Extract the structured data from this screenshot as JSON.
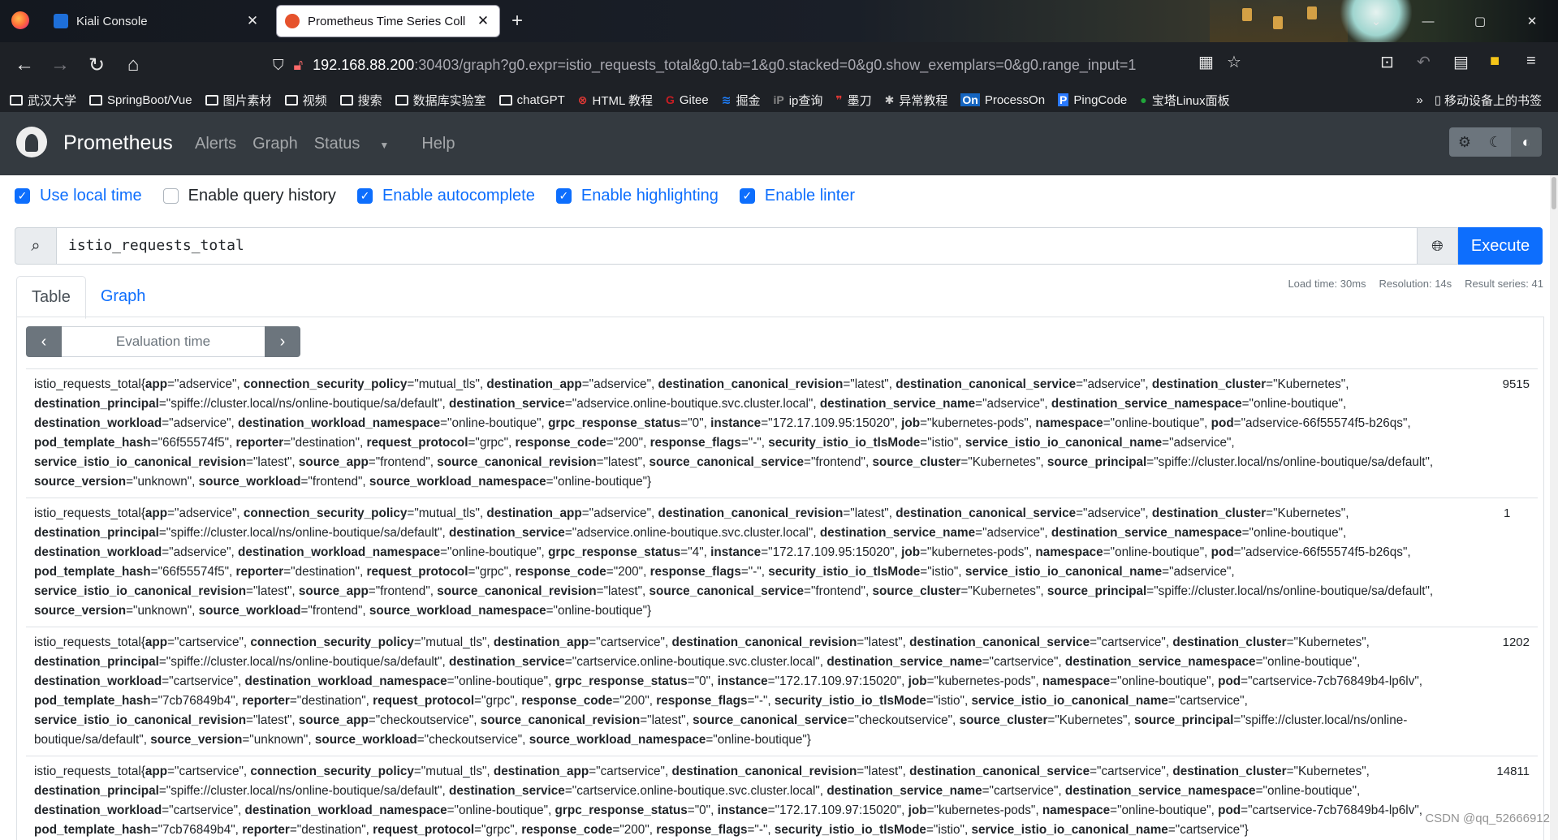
{
  "browser": {
    "tabs": [
      {
        "title": "Kiali Console",
        "active": false
      },
      {
        "title": "Prometheus Time Series Coll",
        "active": true
      }
    ],
    "url_host": "192.168.88.200",
    "url_rest": ":30403/graph?g0.expr=istio_requests_total&g0.tab=1&g0.stacked=0&g0.show_exemplars=0&g0.range_input=1",
    "bookmarks": [
      "武汉大学",
      "SpringBoot/Vue",
      "图片素材",
      "视频",
      "搜索",
      "数据库实验室",
      "chatGPT",
      "HTML 教程",
      "Gitee",
      "掘金",
      "ip查询",
      "墨刀",
      "异常教程",
      "ProcessOn",
      "PingCode",
      "宝塔Linux面板"
    ],
    "mobile_bookmarks": "移动设备上的书签"
  },
  "prometheus": {
    "brand": "Prometheus",
    "nav": [
      "Alerts",
      "Graph",
      "Status",
      "Help"
    ]
  },
  "options": [
    {
      "label": "Use local time",
      "checked": true
    },
    {
      "label": "Enable query history",
      "checked": false
    },
    {
      "label": "Enable autocomplete",
      "checked": true
    },
    {
      "label": "Enable highlighting",
      "checked": true
    },
    {
      "label": "Enable linter",
      "checked": true
    }
  ],
  "query": {
    "expression": "istio_requests_total",
    "execute_label": "Execute"
  },
  "tabs": {
    "table": "Table",
    "graph": "Graph"
  },
  "stats": {
    "load_time": "Load time: 30ms",
    "resolution": "Resolution: 14s",
    "result_series": "Result series: 41"
  },
  "eval_time_placeholder": "Evaluation time",
  "results": [
    {
      "metric": "istio_requests_total",
      "value": "9515",
      "labels": [
        [
          "app",
          "adservice"
        ],
        [
          "connection_security_policy",
          "mutual_tls"
        ],
        [
          "destination_app",
          "adservice"
        ],
        [
          "destination_canonical_revision",
          "latest"
        ],
        [
          "destination_canonical_service",
          "adservice"
        ],
        [
          "destination_cluster",
          "Kubernetes"
        ],
        [
          "destination_principal",
          "spiffe://cluster.local/ns/online-boutique/sa/default"
        ],
        [
          "destination_service",
          "adservice.online-boutique.svc.cluster.local"
        ],
        [
          "destination_service_name",
          "adservice"
        ],
        [
          "destination_service_namespace",
          "online-boutique"
        ],
        [
          "destination_workload",
          "adservice"
        ],
        [
          "destination_workload_namespace",
          "online-boutique"
        ],
        [
          "grpc_response_status",
          "0"
        ],
        [
          "instance",
          "172.17.109.95:15020"
        ],
        [
          "job",
          "kubernetes-pods"
        ],
        [
          "namespace",
          "online-boutique"
        ],
        [
          "pod",
          "adservice-66f55574f5-b26qs"
        ],
        [
          "pod_template_hash",
          "66f55574f5"
        ],
        [
          "reporter",
          "destination"
        ],
        [
          "request_protocol",
          "grpc"
        ],
        [
          "response_code",
          "200"
        ],
        [
          "response_flags",
          "-"
        ],
        [
          "security_istio_io_tlsMode",
          "istio"
        ],
        [
          "service_istio_io_canonical_name",
          "adservice"
        ],
        [
          "service_istio_io_canonical_revision",
          "latest"
        ],
        [
          "source_app",
          "frontend"
        ],
        [
          "source_canonical_revision",
          "latest"
        ],
        [
          "source_canonical_service",
          "frontend"
        ],
        [
          "source_cluster",
          "Kubernetes"
        ],
        [
          "source_principal",
          "spiffe://cluster.local/ns/online-boutique/sa/default"
        ],
        [
          "source_version",
          "unknown"
        ],
        [
          "source_workload",
          "frontend"
        ],
        [
          "source_workload_namespace",
          "online-boutique"
        ]
      ]
    },
    {
      "metric": "istio_requests_total",
      "value": "1",
      "labels": [
        [
          "app",
          "adservice"
        ],
        [
          "connection_security_policy",
          "mutual_tls"
        ],
        [
          "destination_app",
          "adservice"
        ],
        [
          "destination_canonical_revision",
          "latest"
        ],
        [
          "destination_canonical_service",
          "adservice"
        ],
        [
          "destination_cluster",
          "Kubernetes"
        ],
        [
          "destination_principal",
          "spiffe://cluster.local/ns/online-boutique/sa/default"
        ],
        [
          "destination_service",
          "adservice.online-boutique.svc.cluster.local"
        ],
        [
          "destination_service_name",
          "adservice"
        ],
        [
          "destination_service_namespace",
          "online-boutique"
        ],
        [
          "destination_workload",
          "adservice"
        ],
        [
          "destination_workload_namespace",
          "online-boutique"
        ],
        [
          "grpc_response_status",
          "4"
        ],
        [
          "instance",
          "172.17.109.95:15020"
        ],
        [
          "job",
          "kubernetes-pods"
        ],
        [
          "namespace",
          "online-boutique"
        ],
        [
          "pod",
          "adservice-66f55574f5-b26qs"
        ],
        [
          "pod_template_hash",
          "66f55574f5"
        ],
        [
          "reporter",
          "destination"
        ],
        [
          "request_protocol",
          "grpc"
        ],
        [
          "response_code",
          "200"
        ],
        [
          "response_flags",
          "-"
        ],
        [
          "security_istio_io_tlsMode",
          "istio"
        ],
        [
          "service_istio_io_canonical_name",
          "adservice"
        ],
        [
          "service_istio_io_canonical_revision",
          "latest"
        ],
        [
          "source_app",
          "frontend"
        ],
        [
          "source_canonical_revision",
          "latest"
        ],
        [
          "source_canonical_service",
          "frontend"
        ],
        [
          "source_cluster",
          "Kubernetes"
        ],
        [
          "source_principal",
          "spiffe://cluster.local/ns/online-boutique/sa/default"
        ],
        [
          "source_version",
          "unknown"
        ],
        [
          "source_workload",
          "frontend"
        ],
        [
          "source_workload_namespace",
          "online-boutique"
        ]
      ]
    },
    {
      "metric": "istio_requests_total",
      "value": "1202",
      "labels": [
        [
          "app",
          "cartservice"
        ],
        [
          "connection_security_policy",
          "mutual_tls"
        ],
        [
          "destination_app",
          "cartservice"
        ],
        [
          "destination_canonical_revision",
          "latest"
        ],
        [
          "destination_canonical_service",
          "cartservice"
        ],
        [
          "destination_cluster",
          "Kubernetes"
        ],
        [
          "destination_principal",
          "spiffe://cluster.local/ns/online-boutique/sa/default"
        ],
        [
          "destination_service",
          "cartservice.online-boutique.svc.cluster.local"
        ],
        [
          "destination_service_name",
          "cartservice"
        ],
        [
          "destination_service_namespace",
          "online-boutique"
        ],
        [
          "destination_workload",
          "cartservice"
        ],
        [
          "destination_workload_namespace",
          "online-boutique"
        ],
        [
          "grpc_response_status",
          "0"
        ],
        [
          "instance",
          "172.17.109.97:15020"
        ],
        [
          "job",
          "kubernetes-pods"
        ],
        [
          "namespace",
          "online-boutique"
        ],
        [
          "pod",
          "cartservice-7cb76849b4-lp6lv"
        ],
        [
          "pod_template_hash",
          "7cb76849b4"
        ],
        [
          "reporter",
          "destination"
        ],
        [
          "request_protocol",
          "grpc"
        ],
        [
          "response_code",
          "200"
        ],
        [
          "response_flags",
          "-"
        ],
        [
          "security_istio_io_tlsMode",
          "istio"
        ],
        [
          "service_istio_io_canonical_name",
          "cartservice"
        ],
        [
          "service_istio_io_canonical_revision",
          "latest"
        ],
        [
          "source_app",
          "checkoutservice"
        ],
        [
          "source_canonical_revision",
          "latest"
        ],
        [
          "source_canonical_service",
          "checkoutservice"
        ],
        [
          "source_cluster",
          "Kubernetes"
        ],
        [
          "source_principal",
          "spiffe://cluster.local/ns/online-boutique/sa/default"
        ],
        [
          "source_version",
          "unknown"
        ],
        [
          "source_workload",
          "checkoutservice"
        ],
        [
          "source_workload_namespace",
          "online-boutique"
        ]
      ]
    },
    {
      "metric": "istio_requests_total",
      "value": "14811",
      "labels": [
        [
          "app",
          "cartservice"
        ],
        [
          "connection_security_policy",
          "mutual_tls"
        ],
        [
          "destination_app",
          "cartservice"
        ],
        [
          "destination_canonical_revision",
          "latest"
        ],
        [
          "destination_canonical_service",
          "cartservice"
        ],
        [
          "destination_cluster",
          "Kubernetes"
        ],
        [
          "destination_principal",
          "spiffe://cluster.local/ns/online-boutique/sa/default"
        ],
        [
          "destination_service",
          "cartservice.online-boutique.svc.cluster.local"
        ],
        [
          "destination_service_name",
          "cartservice"
        ],
        [
          "destination_service_namespace",
          "online-boutique"
        ],
        [
          "destination_workload",
          "cartservice"
        ],
        [
          "destination_workload_namespace",
          "online-boutique"
        ],
        [
          "grpc_response_status",
          "0"
        ],
        [
          "instance",
          "172.17.109.97:15020"
        ],
        [
          "job",
          "kubernetes-pods"
        ],
        [
          "namespace",
          "online-boutique"
        ],
        [
          "pod",
          "cartservice-7cb76849b4-lp6lv"
        ],
        [
          "pod_template_hash",
          "7cb76849b4"
        ],
        [
          "reporter",
          "destination"
        ],
        [
          "request_protocol",
          "grpc"
        ],
        [
          "response_code",
          "200"
        ],
        [
          "response_flags",
          "-"
        ],
        [
          "security_istio_io_tlsMode",
          "istio"
        ],
        [
          "service_istio_io_canonical_name",
          "cartservice"
        ]
      ]
    }
  ],
  "watermark": "CSDN @qq_52666912"
}
